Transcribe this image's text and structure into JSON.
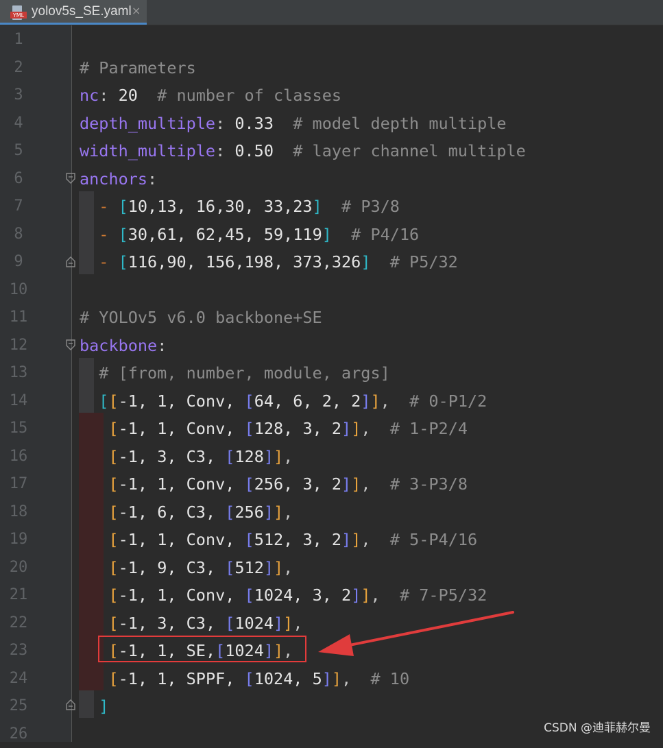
{
  "tab": {
    "title": "yolov5s_SE.yaml",
    "close": "×",
    "icon": "yaml-file-icon",
    "icon_text": "YML"
  },
  "editor": {
    "lines": [
      {
        "n": "1",
        "tokens": []
      },
      {
        "n": "2",
        "tokens": [
          {
            "t": "# Parameters",
            "c": "c-comment"
          }
        ]
      },
      {
        "n": "3",
        "tokens": [
          {
            "t": "nc",
            "c": "c-key"
          },
          {
            "t": ": ",
            "c": "c-punct"
          },
          {
            "t": "20",
            "c": "c-num"
          },
          {
            "t": "  # number of classes",
            "c": "c-comment"
          }
        ]
      },
      {
        "n": "4",
        "tokens": [
          {
            "t": "depth_multiple",
            "c": "c-key"
          },
          {
            "t": ": ",
            "c": "c-punct"
          },
          {
            "t": "0.33",
            "c": "c-num"
          },
          {
            "t": "  # model depth multiple",
            "c": "c-comment"
          }
        ]
      },
      {
        "n": "5",
        "tokens": [
          {
            "t": "width_multiple",
            "c": "c-key"
          },
          {
            "t": ": ",
            "c": "c-punct"
          },
          {
            "t": "0.50",
            "c": "c-num"
          },
          {
            "t": "  # layer channel multiple",
            "c": "c-comment"
          }
        ]
      },
      {
        "n": "6",
        "tokens": [
          {
            "t": "anchors",
            "c": "c-key"
          },
          {
            "t": ":",
            "c": "c-punct"
          }
        ]
      },
      {
        "n": "7",
        "tokens": [
          {
            "t": "  ",
            "c": ""
          },
          {
            "t": "- ",
            "c": "c-dash"
          },
          {
            "t": "[",
            "c": "b1"
          },
          {
            "t": "10,13, 16,30, 33,23",
            "c": "c-num"
          },
          {
            "t": "]",
            "c": "b1"
          },
          {
            "t": "  # P3/8",
            "c": "c-comment"
          }
        ]
      },
      {
        "n": "8",
        "tokens": [
          {
            "t": "  ",
            "c": ""
          },
          {
            "t": "- ",
            "c": "c-dash"
          },
          {
            "t": "[",
            "c": "b1"
          },
          {
            "t": "30,61, 62,45, 59,119",
            "c": "c-num"
          },
          {
            "t": "]",
            "c": "b1"
          },
          {
            "t": "  # P4/16",
            "c": "c-comment"
          }
        ]
      },
      {
        "n": "9",
        "tokens": [
          {
            "t": "  ",
            "c": ""
          },
          {
            "t": "- ",
            "c": "c-dash"
          },
          {
            "t": "[",
            "c": "b1"
          },
          {
            "t": "116,90, 156,198, 373,326",
            "c": "c-num"
          },
          {
            "t": "]",
            "c": "b1"
          },
          {
            "t": "  # P5/32",
            "c": "c-comment"
          }
        ]
      },
      {
        "n": "10",
        "tokens": []
      },
      {
        "n": "11",
        "tokens": [
          {
            "t": "# YOLOv5 v6.0 backbone+SE",
            "c": "c-comment"
          }
        ]
      },
      {
        "n": "12",
        "tokens": [
          {
            "t": "backbone",
            "c": "c-key"
          },
          {
            "t": ":",
            "c": "c-punct"
          }
        ]
      },
      {
        "n": "13",
        "tokens": [
          {
            "t": "  ",
            "c": ""
          },
          {
            "t": "# [from, number, module, args]",
            "c": "c-comment"
          }
        ]
      },
      {
        "n": "14",
        "tokens": [
          {
            "t": "  ",
            "c": ""
          },
          {
            "t": "[",
            "c": "b1"
          },
          {
            "t": "[",
            "c": "b2"
          },
          {
            "t": "-1, 1, Conv, ",
            "c": "c-num"
          },
          {
            "t": "[",
            "c": "b3"
          },
          {
            "t": "64, 6, 2, 2",
            "c": "c-num"
          },
          {
            "t": "]",
            "c": "b3"
          },
          {
            "t": "]",
            "c": "b2"
          },
          {
            "t": ",  ",
            "c": "c-punct"
          },
          {
            "t": "# 0-P1/2",
            "c": "c-comment"
          }
        ]
      },
      {
        "n": "15",
        "tokens": [
          {
            "t": "   ",
            "c": ""
          },
          {
            "t": "[",
            "c": "b2"
          },
          {
            "t": "-1, 1, Conv, ",
            "c": "c-num"
          },
          {
            "t": "[",
            "c": "b3"
          },
          {
            "t": "128, 3, 2",
            "c": "c-num"
          },
          {
            "t": "]",
            "c": "b3"
          },
          {
            "t": "]",
            "c": "b2"
          },
          {
            "t": ",  ",
            "c": "c-punct"
          },
          {
            "t": "# 1-P2/4",
            "c": "c-comment"
          }
        ]
      },
      {
        "n": "16",
        "tokens": [
          {
            "t": "   ",
            "c": ""
          },
          {
            "t": "[",
            "c": "b2"
          },
          {
            "t": "-1, 3, C3, ",
            "c": "c-num"
          },
          {
            "t": "[",
            "c": "b3"
          },
          {
            "t": "128",
            "c": "c-num"
          },
          {
            "t": "]",
            "c": "b3"
          },
          {
            "t": "]",
            "c": "b2"
          },
          {
            "t": ",",
            "c": "c-punct"
          }
        ]
      },
      {
        "n": "17",
        "tokens": [
          {
            "t": "   ",
            "c": ""
          },
          {
            "t": "[",
            "c": "b2"
          },
          {
            "t": "-1, 1, Conv, ",
            "c": "c-num"
          },
          {
            "t": "[",
            "c": "b3"
          },
          {
            "t": "256, 3, 2",
            "c": "c-num"
          },
          {
            "t": "]",
            "c": "b3"
          },
          {
            "t": "]",
            "c": "b2"
          },
          {
            "t": ",  ",
            "c": "c-punct"
          },
          {
            "t": "# 3-P3/8",
            "c": "c-comment"
          }
        ]
      },
      {
        "n": "18",
        "tokens": [
          {
            "t": "   ",
            "c": ""
          },
          {
            "t": "[",
            "c": "b2"
          },
          {
            "t": "-1, 6, C3, ",
            "c": "c-num"
          },
          {
            "t": "[",
            "c": "b3"
          },
          {
            "t": "256",
            "c": "c-num"
          },
          {
            "t": "]",
            "c": "b3"
          },
          {
            "t": "]",
            "c": "b2"
          },
          {
            "t": ",",
            "c": "c-punct"
          }
        ]
      },
      {
        "n": "19",
        "tokens": [
          {
            "t": "   ",
            "c": ""
          },
          {
            "t": "[",
            "c": "b2"
          },
          {
            "t": "-1, 1, Conv, ",
            "c": "c-num"
          },
          {
            "t": "[",
            "c": "b3"
          },
          {
            "t": "512, 3, 2",
            "c": "c-num"
          },
          {
            "t": "]",
            "c": "b3"
          },
          {
            "t": "]",
            "c": "b2"
          },
          {
            "t": ",  ",
            "c": "c-punct"
          },
          {
            "t": "# 5-P4/16",
            "c": "c-comment"
          }
        ]
      },
      {
        "n": "20",
        "tokens": [
          {
            "t": "   ",
            "c": ""
          },
          {
            "t": "[",
            "c": "b2"
          },
          {
            "t": "-1, 9, C3, ",
            "c": "c-num"
          },
          {
            "t": "[",
            "c": "b3"
          },
          {
            "t": "512",
            "c": "c-num"
          },
          {
            "t": "]",
            "c": "b3"
          },
          {
            "t": "]",
            "c": "b2"
          },
          {
            "t": ",",
            "c": "c-punct"
          }
        ]
      },
      {
        "n": "21",
        "tokens": [
          {
            "t": "   ",
            "c": ""
          },
          {
            "t": "[",
            "c": "b2"
          },
          {
            "t": "-1, 1, Conv, ",
            "c": "c-num"
          },
          {
            "t": "[",
            "c": "b3"
          },
          {
            "t": "1024, 3, 2",
            "c": "c-num"
          },
          {
            "t": "]",
            "c": "b3"
          },
          {
            "t": "]",
            "c": "b2"
          },
          {
            "t": ",  ",
            "c": "c-punct"
          },
          {
            "t": "# 7-P5/32",
            "c": "c-comment"
          }
        ]
      },
      {
        "n": "22",
        "tokens": [
          {
            "t": "   ",
            "c": ""
          },
          {
            "t": "[",
            "c": "b2"
          },
          {
            "t": "-1, 3, C3, ",
            "c": "c-num"
          },
          {
            "t": "[",
            "c": "b3"
          },
          {
            "t": "1024",
            "c": "c-num"
          },
          {
            "t": "]",
            "c": "b3"
          },
          {
            "t": "]",
            "c": "b2"
          },
          {
            "t": ",",
            "c": "c-punct"
          }
        ]
      },
      {
        "n": "23",
        "tokens": [
          {
            "t": "   ",
            "c": ""
          },
          {
            "t": "[",
            "c": "b2"
          },
          {
            "t": "-1, 1, SE,",
            "c": "c-num"
          },
          {
            "t": "[",
            "c": "b3"
          },
          {
            "t": "1024",
            "c": "c-num"
          },
          {
            "t": "]",
            "c": "b3"
          },
          {
            "t": "]",
            "c": "b2"
          },
          {
            "t": ",",
            "c": "c-punct"
          }
        ]
      },
      {
        "n": "24",
        "tokens": [
          {
            "t": "   ",
            "c": ""
          },
          {
            "t": "[",
            "c": "b2"
          },
          {
            "t": "-1, 1, SPPF, ",
            "c": "c-num"
          },
          {
            "t": "[",
            "c": "b3"
          },
          {
            "t": "1024, 5",
            "c": "c-num"
          },
          {
            "t": "]",
            "c": "b3"
          },
          {
            "t": "]",
            "c": "b2"
          },
          {
            "t": ",  ",
            "c": "c-punct"
          },
          {
            "t": "# 10",
            "c": "c-comment"
          }
        ]
      },
      {
        "n": "25",
        "tokens": [
          {
            "t": "  ",
            "c": ""
          },
          {
            "t": "]",
            "c": "b1"
          }
        ]
      },
      {
        "n": "26",
        "tokens": []
      }
    ]
  },
  "annotation": {
    "highlight_color": "#e33b3b",
    "arrow_color": "#e03c3c"
  },
  "watermark": "CSDN @迪菲赫尔曼",
  "colors": {
    "background": "#2b2b2b",
    "gutter": "#313335",
    "key": "#9876f0",
    "comment": "#8c8c8c",
    "bracket_outer": "#2fb8c7",
    "bracket_mid": "#e8a33d",
    "bracket_inner": "#7a7ff2"
  }
}
